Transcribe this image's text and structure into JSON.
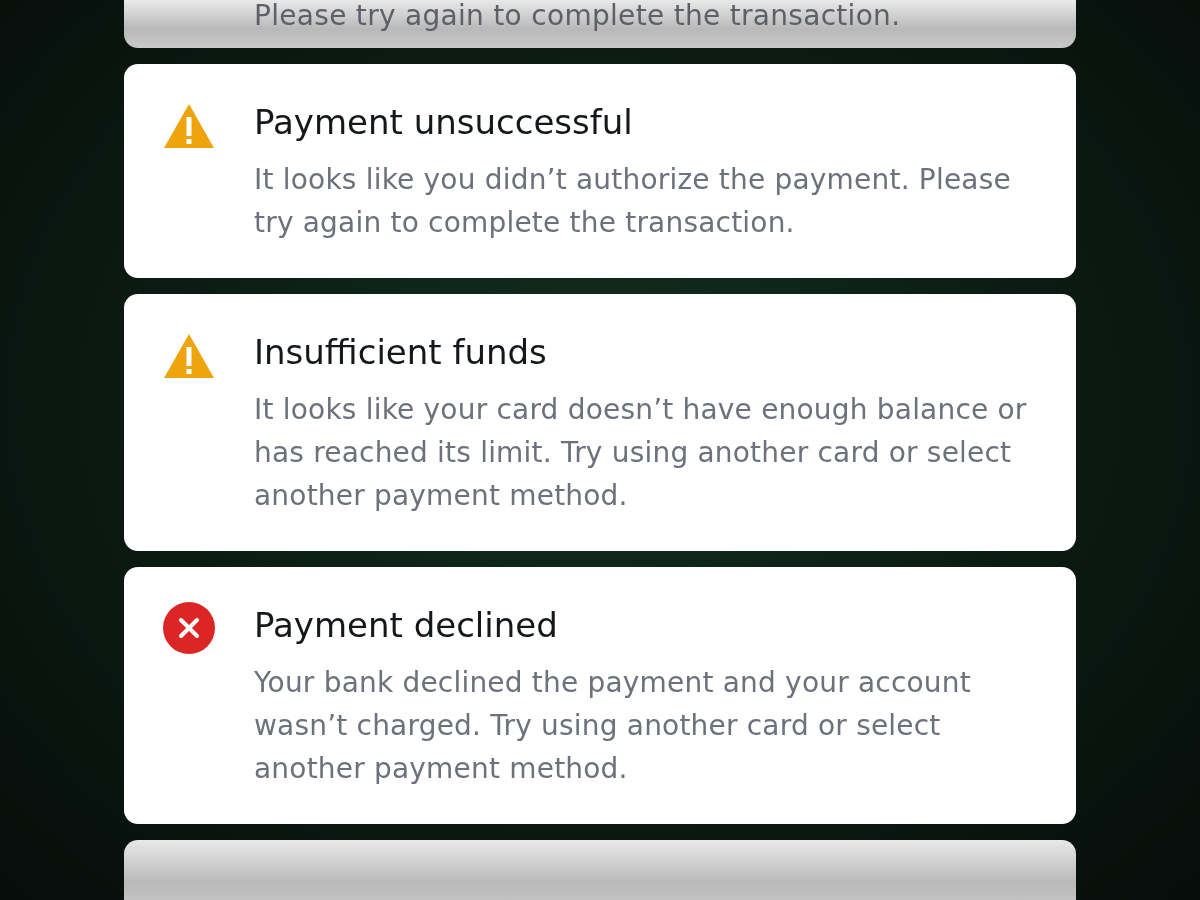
{
  "partial_card_top": {
    "message": "Please try again to complete the transaction."
  },
  "alerts": [
    {
      "kind": "warning",
      "title": "Payment unsuccessful",
      "message": "It looks like you didn’t authorize the payment. Please try again to complete the transaction."
    },
    {
      "kind": "warning",
      "title": "Insufficient funds",
      "message": "It looks like your card doesn’t have enough balance or has reached its limit. Try using another card or select another payment method."
    },
    {
      "kind": "error",
      "title": "Payment declined",
      "message": "Your bank declined the payment and your account wasn’t charged. Try using another card or select another payment method."
    }
  ]
}
